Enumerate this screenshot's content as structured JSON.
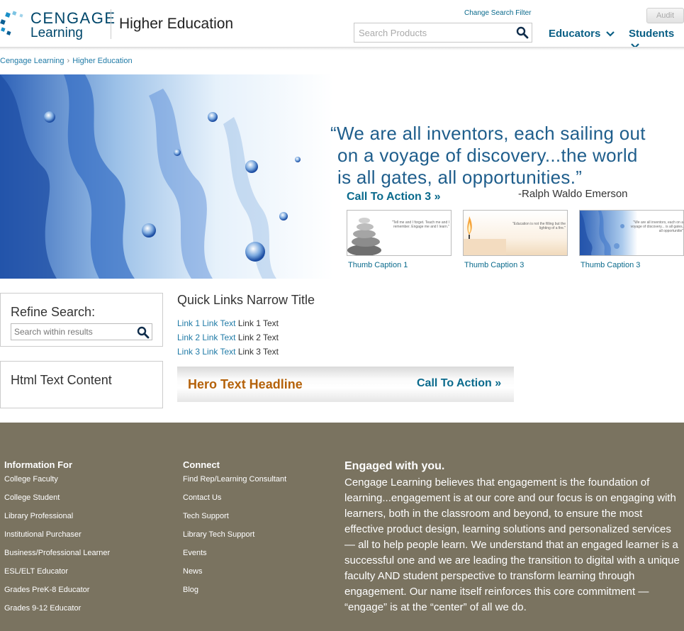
{
  "header": {
    "logo_top": "CENGAGE",
    "logo_bottom": "Learning",
    "division_title": "Higher Education",
    "change_filter": "Change Search Filter",
    "search_placeholder": "Search Products",
    "nav": [
      {
        "label": "Educators"
      },
      {
        "label": "Students"
      }
    ],
    "audit_label": "Audit"
  },
  "breadcrumb": {
    "items": [
      "Cengage Learning",
      "Higher Education"
    ]
  },
  "hero": {
    "quote_line1": "“We are all inventors, each sailing out",
    "quote_line2": "on a voyage of discovery...the world",
    "quote_line3": "is all gates, all opportunities.”",
    "attribution": "-Ralph Waldo Emerson",
    "cta_label": "Call To Action 3",
    "thumbs": [
      {
        "caption": "Thumb Caption 1",
        "quote": "\"Tell me and I forget. Teach me and I remember. Engage me and I learn.\""
      },
      {
        "caption": "Thumb Caption 3",
        "quote": "\"Education is not the filling but the lighting of a fire.\""
      },
      {
        "caption": "Thumb Caption 3",
        "quote": "\"We are all inventors, each on a voyage of discovery... is all gates, all opportunitie\""
      }
    ]
  },
  "refine": {
    "title": "Refine Search:",
    "placeholder": "Search within results"
  },
  "html_box": {
    "text": "Html Text Content"
  },
  "quick_links": {
    "title": "Quick Links Narrow Title",
    "items": [
      {
        "link": "Link 1 Link Text",
        "text": "Link 1 Text"
      },
      {
        "link": "Link 2 Link Text",
        "text": "Link 2 Text"
      },
      {
        "link": "Link 3 Link Text",
        "text": "Link 3 Text"
      }
    ]
  },
  "hero_bar": {
    "headline": "Hero Text Headline",
    "cta_label": "Call To Action"
  },
  "footer": {
    "info_title": "Information For",
    "info_links": [
      "College Faculty",
      "College Student",
      "Library Professional",
      "Institutional Purchaser",
      "Business/Professional Learner",
      "ESL/ELT Educator",
      "Grades PreK-8 Educator",
      "Grades 9-12 Educator"
    ],
    "connect_title": "Connect",
    "connect_links": [
      "Find Rep/Learning Consultant",
      "Contact Us",
      "Tech Support",
      "Library Tech Support",
      "Events",
      "News",
      "Blog"
    ],
    "engaged_title": "Engaged with you.",
    "engaged_body": "Cengage Learning believes that engagement is the foundation of learning...engagement is at our core and our focus is on engaging with learners, both in the classroom and beyond, to ensure the most effective product design, learning solutions and personalized services — all to help people learn. We understand that an engaged learner is a successful one and we are leading the transition to digital with a unique faculty AND student perspective to transform learning through engagement. Our name itself reinforces this core commitment — “engage” is at the “center” of all we do."
  },
  "colors": {
    "brand_blue": "#00476b",
    "link_blue": "#0a6a8c",
    "hero_orange": "#b5620a",
    "footer_bg": "#7a7360"
  },
  "icons": {
    "search": "search-icon",
    "chevron": "chevron-down-icon",
    "double_chevron": "double-chevron-right-icon"
  }
}
